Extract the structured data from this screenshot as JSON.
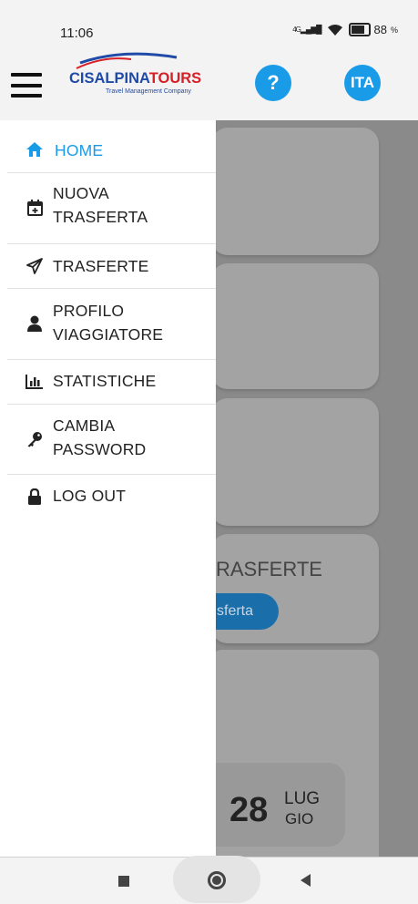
{
  "status_bar": {
    "time": "11:06",
    "network": "4G",
    "battery": "88",
    "battery_level": 0.88
  },
  "header": {
    "logo_main": "CISALPINATOURS",
    "logo_main_a": "CISALPINA",
    "logo_main_b": "TOURS",
    "logo_sub": "Travel Management Company",
    "help_label": "?",
    "lang_label": "ITA"
  },
  "menu": {
    "items": [
      {
        "label": "HOME",
        "icon": "home-icon",
        "active": true
      },
      {
        "label": "NUOVA TRASFERTA",
        "line1": "NUOVA",
        "line2": "TRASFERTA",
        "icon": "calendar-plus-icon"
      },
      {
        "label": "TRASFERTE",
        "icon": "paper-plane-icon"
      },
      {
        "label": "PROFILO VIAGGIATORE",
        "line1": "PROFILO",
        "line2": "VIAGGIATORE",
        "icon": "user-icon"
      },
      {
        "label": "STATISTICHE",
        "icon": "bar-chart-icon"
      },
      {
        "label": "CAMBIA PASSWORD",
        "line1": "CAMBIA",
        "line2": "PASSWORD",
        "icon": "key-icon"
      },
      {
        "label": "LOG OUT",
        "icon": "lock-icon"
      }
    ]
  },
  "background": {
    "section_title_partial": "RASFERTE",
    "button_partial": "sferta",
    "date_day_number": "28",
    "date_month": "LUG",
    "date_weekday": "GIO"
  },
  "colors": {
    "accent": "#1a9be8",
    "logo_red": "#d61f26",
    "logo_blue": "#1f4aa8"
  }
}
